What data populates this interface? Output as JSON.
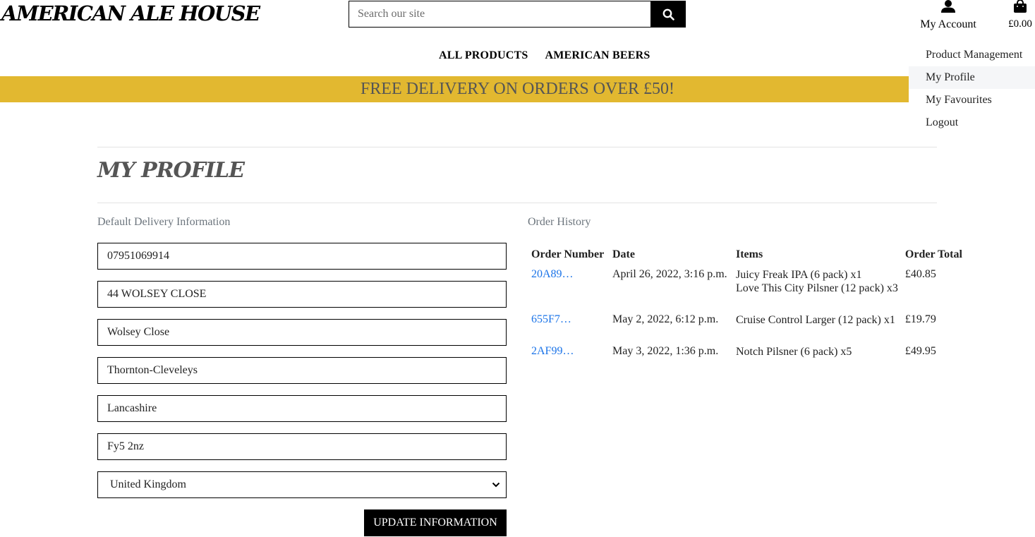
{
  "header": {
    "logo": "AMERICAN ALE HOUSE",
    "search_placeholder": "Search our site",
    "account_label": "My Account",
    "cart_total": "£0.00"
  },
  "nav": {
    "items": [
      {
        "label": "ALL PRODUCTS"
      },
      {
        "label": "AMERICAN BEERS"
      }
    ]
  },
  "banner": {
    "text": "FREE DELIVERY ON ORDERS OVER £50!",
    "color": "#e2b830"
  },
  "account_menu": {
    "items": [
      {
        "label": "Product Management"
      },
      {
        "label": "My Profile"
      },
      {
        "label": "My Favourites"
      },
      {
        "label": "Logout"
      }
    ]
  },
  "page": {
    "title": "MY PROFILE"
  },
  "delivery": {
    "heading": "Default Delivery Information",
    "fields": {
      "phone": "07951069914",
      "street1": "44 WOLSEY CLOSE",
      "street2": "Wolsey Close",
      "town": "Thornton-Cleveleys",
      "county": "Lancashire",
      "postcode": "Fy5 2nz",
      "country": "United Kingdom"
    },
    "submit_label": "UPDATE INFORMATION"
  },
  "orders": {
    "heading": "Order History",
    "columns": [
      "Order Number",
      "Date",
      "Items",
      "Order Total"
    ],
    "rows": [
      {
        "number": "20A89…",
        "date": "April 26, 2022, 3:16 p.m.",
        "item1": "Juicy Freak IPA (6 pack) x1",
        "item2": "Love This City Pilsner (12 pack) x3",
        "total": "£40.85"
      },
      {
        "number": "655F7…",
        "date": "May 2, 2022, 6:12 p.m.",
        "item1": "Cruise Control Larger (12 pack) x1",
        "total": "£19.79"
      },
      {
        "number": "2AF99…",
        "date": "May 3, 2022, 1:36 p.m.",
        "item1": "Notch Pilsner (6 pack) x5",
        "total": "£49.95"
      }
    ],
    "link_color": "#1a73e8"
  }
}
